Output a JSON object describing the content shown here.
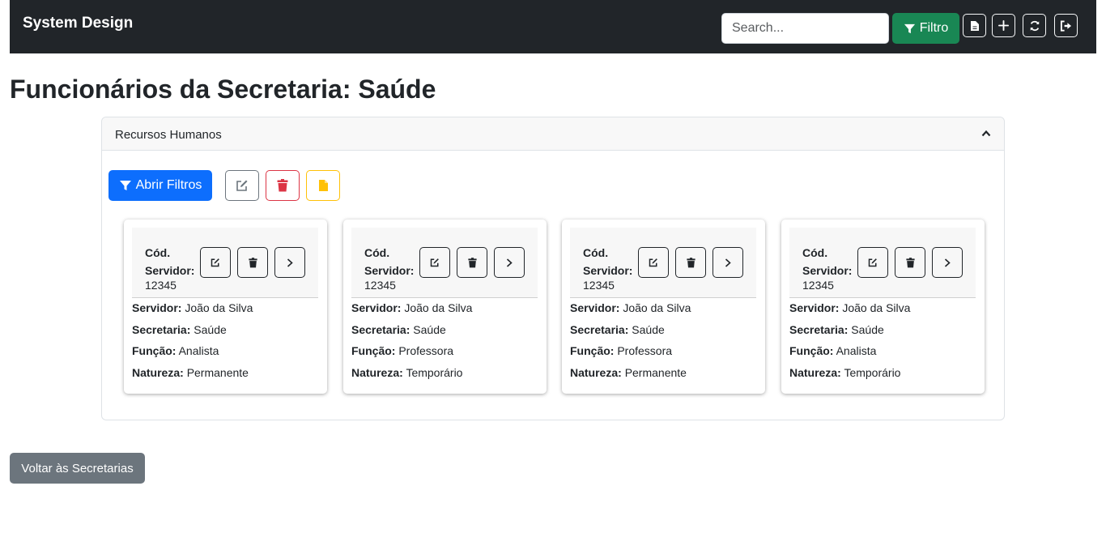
{
  "navbar": {
    "brand": "System Design",
    "search_placeholder": "Search...",
    "filtro_label": "Filtro"
  },
  "page_title": "Funcionários da Secretaria: Saúde",
  "accordion": {
    "title": "Recursos Humanos",
    "abrir_filtros_label": "Abrir Filtros"
  },
  "labels": {
    "cod": "Cód. Servidor:",
    "servidor": "Servidor:",
    "secretaria": "Secretaria:",
    "funcao": "Função:",
    "natureza": "Natureza:"
  },
  "cards": [
    {
      "cod": "12345",
      "servidor": "João da Silva",
      "secretaria": "Saúde",
      "funcao": "Analista",
      "natureza": "Permanente"
    },
    {
      "cod": "12345",
      "servidor": "João da Silva",
      "secretaria": "Saúde",
      "funcao": "Professora",
      "natureza": "Temporário"
    },
    {
      "cod": "12345",
      "servidor": "João da Silva",
      "secretaria": "Saúde",
      "funcao": "Professora",
      "natureza": "Permanente"
    },
    {
      "cod": "12345",
      "servidor": "João da Silva",
      "secretaria": "Saúde",
      "funcao": "Analista",
      "natureza": "Temporário"
    }
  ],
  "voltar_label": "Voltar às Secretarias",
  "colors": {
    "navbar": "#212529",
    "success": "#198754",
    "primary": "#0d6efd",
    "danger": "#dc3545",
    "warning": "#ffc107",
    "secondary": "#6c757d"
  },
  "icons": [
    "filter-icon",
    "file-icon",
    "plus-icon",
    "refresh-icon",
    "logout-icon",
    "chevron-up-icon",
    "edit-icon",
    "trash-icon",
    "chevron-right-icon"
  ]
}
